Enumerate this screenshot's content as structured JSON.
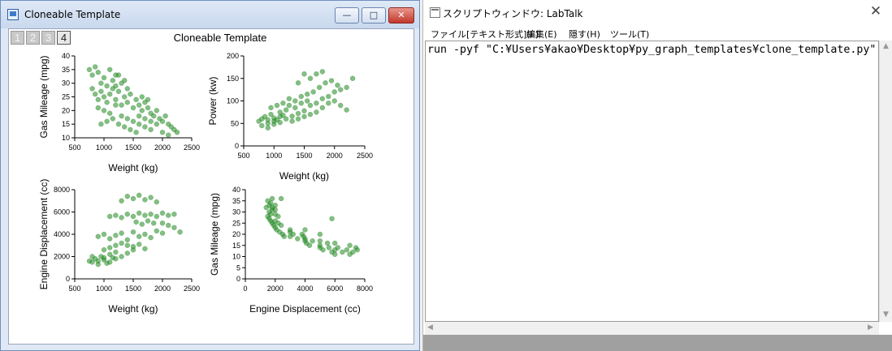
{
  "graph_window": {
    "title": "Cloneable Template",
    "buttons": {
      "minimize": "—",
      "maximize": "□",
      "close": "✕"
    },
    "layer_tabs": [
      {
        "label": "1",
        "active": false
      },
      {
        "label": "2",
        "active": false
      },
      {
        "label": "3",
        "active": false
      },
      {
        "label": "4",
        "active": true
      }
    ],
    "graph_title": "Cloneable Template"
  },
  "script_window": {
    "title": "スクリプトウィンドウ: LabTalk",
    "close_label": "✕",
    "menu": [
      {
        "label": "ファイル[テキスト形式](F)"
      },
      {
        "label": "編集(E)"
      },
      {
        "label": "隠す(H)"
      },
      {
        "label": "ツール(T)"
      }
    ],
    "code": "run -pyf \"C:¥Users¥akao¥Desktop¥py_graph_templates¥clone_template.py\""
  },
  "colors": {
    "marker": "#1e8a1e",
    "marker_stroke": "#0f6a0f"
  },
  "chart_data": [
    {
      "type": "scatter",
      "xlabel": "Weight (kg)",
      "ylabel": "Gas Mileage (mpg)",
      "xlim": [
        500,
        2500
      ],
      "ylim": [
        10,
        40
      ],
      "xticks": [
        "500",
        "1000",
        "1500",
        "2000",
        "2500"
      ],
      "yticks": [
        "10",
        "15",
        "20",
        "25",
        "30",
        "35",
        "40"
      ],
      "points": [
        [
          750,
          35
        ],
        [
          800,
          33
        ],
        [
          850,
          36
        ],
        [
          900,
          34
        ],
        [
          950,
          30
        ],
        [
          1000,
          32
        ],
        [
          1050,
          29
        ],
        [
          1100,
          35
        ],
        [
          1150,
          31
        ],
        [
          1200,
          33
        ],
        [
          800,
          28
        ],
        [
          850,
          26
        ],
        [
          900,
          24
        ],
        [
          950,
          27
        ],
        [
          1000,
          25
        ],
        [
          1050,
          23
        ],
        [
          1100,
          26
        ],
        [
          1150,
          28
        ],
        [
          1200,
          24
        ],
        [
          1250,
          27
        ],
        [
          1300,
          22
        ],
        [
          1350,
          25
        ],
        [
          1400,
          23
        ],
        [
          1450,
          26
        ],
        [
          1500,
          21
        ],
        [
          1550,
          24
        ],
        [
          1600,
          22
        ],
        [
          1650,
          20
        ],
        [
          1700,
          23
        ],
        [
          1750,
          21
        ],
        [
          1800,
          19
        ],
        [
          1850,
          18
        ],
        [
          1900,
          20
        ],
        [
          1950,
          17
        ],
        [
          2000,
          16
        ],
        [
          2050,
          18
        ],
        [
          2100,
          15
        ],
        [
          2150,
          14
        ],
        [
          2200,
          13
        ],
        [
          2250,
          12
        ],
        [
          900,
          21
        ],
        [
          1000,
          20
        ],
        [
          1100,
          19
        ],
        [
          1200,
          22
        ],
        [
          1300,
          18
        ],
        [
          1400,
          17
        ],
        [
          1500,
          16
        ],
        [
          1600,
          15
        ],
        [
          1700,
          14
        ],
        [
          1800,
          13
        ],
        [
          1900,
          15
        ],
        [
          2000,
          12
        ],
        [
          2100,
          11
        ],
        [
          950,
          15
        ],
        [
          1050,
          16
        ],
        [
          1150,
          17
        ],
        [
          1250,
          15
        ],
        [
          1350,
          14
        ],
        [
          1450,
          13
        ],
        [
          1550,
          12
        ],
        [
          1200,
          29
        ],
        [
          1300,
          30
        ],
        [
          1400,
          28
        ],
        [
          1350,
          31
        ],
        [
          1250,
          33
        ],
        [
          1600,
          18
        ],
        [
          1700,
          17
        ],
        [
          1800,
          16
        ],
        [
          1650,
          25
        ],
        [
          1750,
          24
        ]
      ]
    },
    {
      "type": "scatter",
      "xlabel": "Weight (kg)",
      "ylabel": "Power (kw)",
      "xlim": [
        500,
        2500
      ],
      "ylim": [
        0,
        200
      ],
      "xticks": [
        "500",
        "1000",
        "1500",
        "2000",
        "2500"
      ],
      "yticks": [
        "0",
        "50",
        "100",
        "150",
        "200"
      ],
      "points": [
        [
          750,
          55
        ],
        [
          800,
          60
        ],
        [
          850,
          65
        ],
        [
          900,
          50
        ],
        [
          950,
          70
        ],
        [
          1000,
          62
        ],
        [
          1050,
          58
        ],
        [
          1100,
          75
        ],
        [
          1150,
          68
        ],
        [
          1200,
          80
        ],
        [
          800,
          45
        ],
        [
          900,
          40
        ],
        [
          1000,
          48
        ],
        [
          1100,
          52
        ],
        [
          1200,
          60
        ],
        [
          1300,
          66
        ],
        [
          1400,
          72
        ],
        [
          1500,
          78
        ],
        [
          1600,
          90
        ],
        [
          1700,
          95
        ],
        [
          1800,
          105
        ],
        [
          1900,
          110
        ],
        [
          2000,
          120
        ],
        [
          2100,
          125
        ],
        [
          2200,
          130
        ],
        [
          2300,
          150
        ],
        [
          1250,
          90
        ],
        [
          1350,
          100
        ],
        [
          1450,
          110
        ],
        [
          1550,
          115
        ],
        [
          1650,
          120
        ],
        [
          1750,
          130
        ],
        [
          1850,
          140
        ],
        [
          1950,
          145
        ],
        [
          2050,
          135
        ],
        [
          1300,
          55
        ],
        [
          1400,
          60
        ],
        [
          1500,
          65
        ],
        [
          1600,
          70
        ],
        [
          1700,
          75
        ],
        [
          1800,
          85
        ],
        [
          1900,
          95
        ],
        [
          2000,
          100
        ],
        [
          2100,
          90
        ],
        [
          2200,
          80
        ],
        [
          1150,
          95
        ],
        [
          1250,
          105
        ],
        [
          1350,
          85
        ],
        [
          1450,
          95
        ],
        [
          1550,
          100
        ],
        [
          1500,
          160
        ],
        [
          1600,
          150
        ],
        [
          1400,
          140
        ],
        [
          1700,
          160
        ],
        [
          1800,
          165
        ],
        [
          950,
          85
        ],
        [
          1050,
          90
        ],
        [
          1100,
          65
        ],
        [
          1000,
          55
        ],
        [
          900,
          58
        ]
      ]
    },
    {
      "type": "scatter",
      "xlabel": "Weight (kg)",
      "ylabel": "Engine Displacement (cc)",
      "xlim": [
        500,
        2500
      ],
      "ylim": [
        0,
        8000
      ],
      "xticks": [
        "500",
        "1000",
        "1500",
        "2000",
        "2500"
      ],
      "yticks": [
        "0",
        "2000",
        "4000",
        "6000",
        "8000"
      ],
      "points": [
        [
          750,
          1600
        ],
        [
          800,
          1500
        ],
        [
          850,
          1800
        ],
        [
          900,
          1300
        ],
        [
          950,
          2000
        ],
        [
          1000,
          1700
        ],
        [
          1050,
          1400
        ],
        [
          1100,
          2200
        ],
        [
          1150,
          1900
        ],
        [
          1200,
          2400
        ],
        [
          800,
          2000
        ],
        [
          900,
          1600
        ],
        [
          1000,
          1900
        ],
        [
          1100,
          1500
        ],
        [
          1200,
          1800
        ],
        [
          1300,
          2000
        ],
        [
          1400,
          2300
        ],
        [
          1500,
          2600
        ],
        [
          900,
          3800
        ],
        [
          1000,
          4000
        ],
        [
          1100,
          3600
        ],
        [
          1200,
          3900
        ],
        [
          1300,
          4100
        ],
        [
          1400,
          3500
        ],
        [
          1500,
          4200
        ],
        [
          1600,
          3800
        ],
        [
          1700,
          4000
        ],
        [
          1800,
          3700
        ],
        [
          1900,
          4300
        ],
        [
          2000,
          4100
        ],
        [
          1100,
          5600
        ],
        [
          1200,
          5700
        ],
        [
          1300,
          5500
        ],
        [
          1400,
          5800
        ],
        [
          1500,
          5600
        ],
        [
          1600,
          5900
        ],
        [
          1700,
          5700
        ],
        [
          1800,
          5800
        ],
        [
          1900,
          5600
        ],
        [
          2000,
          5900
        ],
        [
          2100,
          5700
        ],
        [
          2200,
          5800
        ],
        [
          1300,
          7000
        ],
        [
          1400,
          7400
        ],
        [
          1500,
          7200
        ],
        [
          1600,
          7500
        ],
        [
          1700,
          7100
        ],
        [
          1800,
          7300
        ],
        [
          1900,
          6900
        ],
        [
          2000,
          5000
        ],
        [
          2100,
          4800
        ],
        [
          2200,
          4600
        ],
        [
          2300,
          4200
        ],
        [
          1000,
          2600
        ],
        [
          1100,
          2800
        ],
        [
          1200,
          3000
        ],
        [
          1300,
          3200
        ],
        [
          1400,
          3000
        ],
        [
          1500,
          2900
        ],
        [
          1600,
          3100
        ],
        [
          1700,
          2700
        ],
        [
          1550,
          5100
        ],
        [
          1650,
          4900
        ],
        [
          1750,
          5200
        ],
        [
          1850,
          5000
        ]
      ]
    },
    {
      "type": "scatter",
      "xlabel": "Engine Displacement (cc)",
      "ylabel": "Gas Mileage (mpg)",
      "xlim": [
        0,
        8000
      ],
      "ylim": [
        0,
        40
      ],
      "xticks": [
        "0",
        "2000",
        "4000",
        "6000",
        "8000"
      ],
      "yticks": [
        "0",
        "5",
        "10",
        "15",
        "20",
        "25",
        "30",
        "35",
        "40"
      ],
      "points": [
        [
          1500,
          35
        ],
        [
          1600,
          33
        ],
        [
          1700,
          34
        ],
        [
          1800,
          32
        ],
        [
          1600,
          30
        ],
        [
          1700,
          29
        ],
        [
          1800,
          31
        ],
        [
          1500,
          28
        ],
        [
          1600,
          27
        ],
        [
          1700,
          26
        ],
        [
          1800,
          25
        ],
        [
          1900,
          24
        ],
        [
          2000,
          33
        ],
        [
          2000,
          29
        ],
        [
          2000,
          26
        ],
        [
          2000,
          23
        ],
        [
          2100,
          22
        ],
        [
          2200,
          28
        ],
        [
          2200,
          25
        ],
        [
          2300,
          21
        ],
        [
          2400,
          24
        ],
        [
          2500,
          20
        ],
        [
          2600,
          19
        ],
        [
          3000,
          21
        ],
        [
          3000,
          19
        ],
        [
          3200,
          20
        ],
        [
          3500,
          18
        ],
        [
          3800,
          20
        ],
        [
          3900,
          19
        ],
        [
          4000,
          18
        ],
        [
          4000,
          17
        ],
        [
          4100,
          16
        ],
        [
          4300,
          15
        ],
        [
          5000,
          17
        ],
        [
          5000,
          15
        ],
        [
          5000,
          14
        ],
        [
          5200,
          13
        ],
        [
          5500,
          16
        ],
        [
          5600,
          14
        ],
        [
          5800,
          12
        ],
        [
          6000,
          13
        ],
        [
          6000,
          11
        ],
        [
          6200,
          14
        ],
        [
          6500,
          12
        ],
        [
          6800,
          13
        ],
        [
          7000,
          11
        ],
        [
          7200,
          12
        ],
        [
          7400,
          14
        ],
        [
          7500,
          13
        ],
        [
          5800,
          27
        ],
        [
          1400,
          32
        ],
        [
          2000,
          31
        ],
        [
          1800,
          36
        ],
        [
          2400,
          36
        ],
        [
          3000,
          22
        ],
        [
          4500,
          17
        ],
        [
          5000,
          20
        ],
        [
          6000,
          16
        ],
        [
          7000,
          15
        ],
        [
          4000,
          22
        ]
      ]
    }
  ]
}
